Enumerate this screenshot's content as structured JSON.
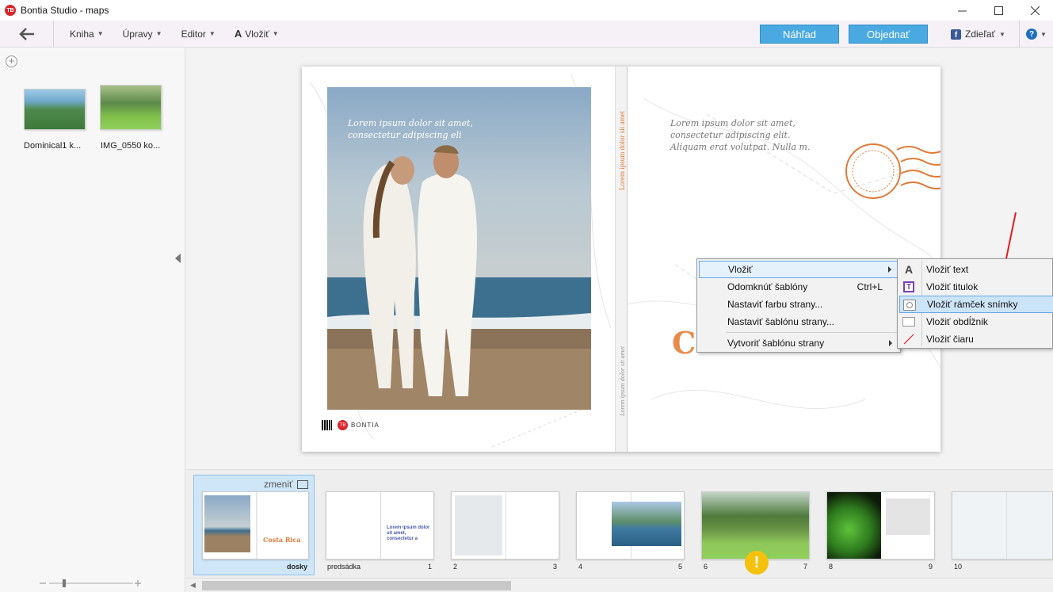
{
  "window": {
    "title": "Bontia Studio - maps",
    "logo": "TB"
  },
  "toolbar": {
    "menus": [
      {
        "label": "Kniha"
      },
      {
        "label": "Úpravy"
      },
      {
        "label": "Editor"
      },
      {
        "label": "Vložiť"
      }
    ],
    "preview_label": "Náhľad",
    "order_label": "Objednať",
    "share_label": "Zdieľať",
    "help_label": "?"
  },
  "images": [
    {
      "label": "Dominical1 k..."
    },
    {
      "label": "IMG_0550 ko..."
    }
  ],
  "canvas": {
    "photo_caption": "Lorem ipsum dolor sit amet, consectetur adipiscing eli",
    "spine_title": "Lorem ipsum dolor sit amet",
    "spine_subtitle": "Lorem ipsum dolor sit amet",
    "right_text": "Lorem ipsum dolor sit amet, consectetur adipiscing elit. Aliquam erat volutpat. Nulla m.",
    "big_letter": "C",
    "brand_text": "BONTIA"
  },
  "context_menu": {
    "items": [
      {
        "label": "Vložiť",
        "shortcut": "",
        "submenu": true
      },
      {
        "label": "Odomknúť šablóny",
        "shortcut": "Ctrl+L",
        "submenu": false
      },
      {
        "label": "Nastaviť farbu strany...",
        "shortcut": "",
        "submenu": false
      },
      {
        "label": "Nastaviť šablónu strany...",
        "shortcut": "",
        "submenu": false
      },
      {
        "label": "Vytvoriť šablónu strany",
        "shortcut": "",
        "submenu": true
      }
    ]
  },
  "submenu": {
    "items": [
      {
        "label": "Vložiť text",
        "icon": "A"
      },
      {
        "label": "Vložiť titulok",
        "icon": "T"
      },
      {
        "label": "Vložiť rámček snímky",
        "icon": ""
      },
      {
        "label": "Vložiť obdĺžnik",
        "icon": ""
      },
      {
        "label": "Vložiť čiaru",
        "icon": ""
      }
    ]
  },
  "thumbnails": {
    "change_label": "zmeniť",
    "labels": {
      "cover": "dosky",
      "endpaper": "predsádka",
      "p1": "1",
      "p2": "2",
      "p3": "3",
      "p4": "4",
      "p5": "5",
      "p6": "6",
      "p7": "7",
      "p8": "8",
      "p9": "9",
      "p10": "10"
    },
    "cover_title": "Costa Rica",
    "thumb_text": "Lorem ipsum dolor sit amet, consectetur a",
    "warn": "!"
  },
  "colors": {
    "accent": "#4aa9e0",
    "brand": "#d9252b",
    "orange": "#e07b39"
  }
}
